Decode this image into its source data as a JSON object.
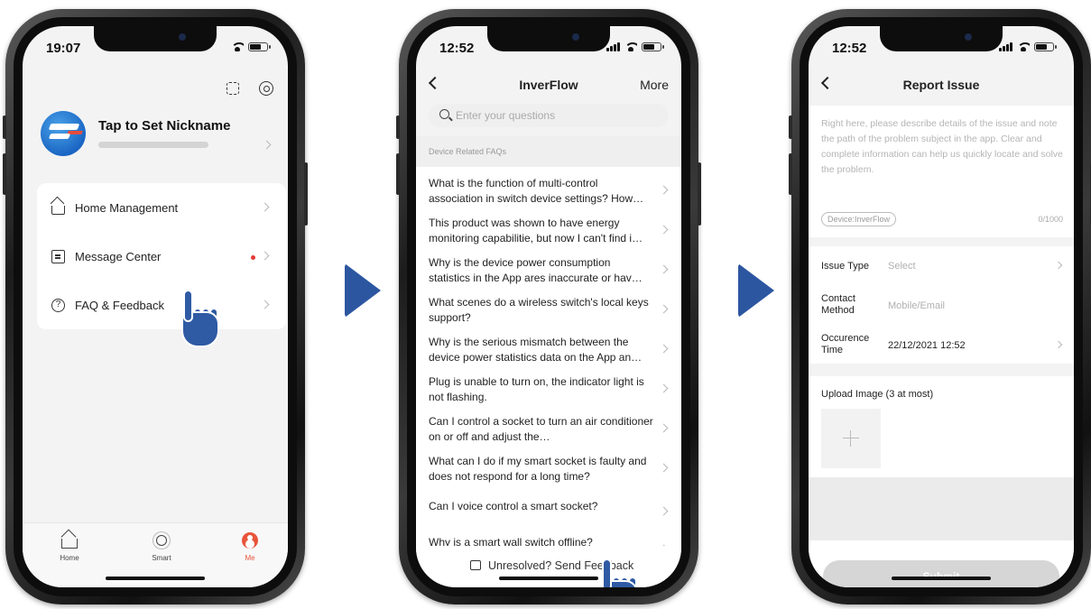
{
  "phone1": {
    "time": "19:07",
    "nickname": "Tap to Set Nickname",
    "menu": [
      {
        "label": "Home Management"
      },
      {
        "label": "Message Center"
      },
      {
        "label": "FAQ & Feedback"
      }
    ],
    "tabs": [
      {
        "label": "Home"
      },
      {
        "label": "Smart"
      },
      {
        "label": "Me"
      }
    ]
  },
  "phone2": {
    "time": "12:52",
    "title": "InverFlow",
    "more": "More",
    "search_placeholder": "Enter your questions",
    "section": "Device Related FAQs",
    "faqs": [
      "What is the function of multi-control association in switch device settings? How…",
      "This product was shown to have energy monitoring capabilitie, but now I can't find i…",
      "Why is the device power consumption statistics in the App ares inaccurate or hav…",
      "What scenes do a wireless switch's local keys support?",
      "Why is the serious mismatch between the device power statistics data on the App an…",
      "Plug is unable to turn on, the indicator light is not flashing.",
      "Can I control a socket to turn an air conditioner on or off and adjust the…",
      "What can I do if my smart socket is faulty and does not respond for a long time?",
      "Can I voice control a smart socket?",
      "Why is a smart wall switch offline?"
    ],
    "feedback": "Unresolved? Send Feedback"
  },
  "phone3": {
    "time": "12:52",
    "title": "Report Issue",
    "description_placeholder": "Right here, please describe details of the issue and note the path of the problem subject in the app. Clear and complete information can help us quickly locate and solve the problem.",
    "device_tag": "Device:InverFlow",
    "char_count": "0/1000",
    "issue_type_label": "Issue Type",
    "issue_type_value": "Select",
    "contact_label": "Contact Method",
    "contact_value": "Mobile/Email",
    "time_label": "Occurence Time",
    "time_value": "22/12/2021 12:52",
    "upload_label": "Upload Image (3 at most)",
    "submit": "Submit"
  }
}
